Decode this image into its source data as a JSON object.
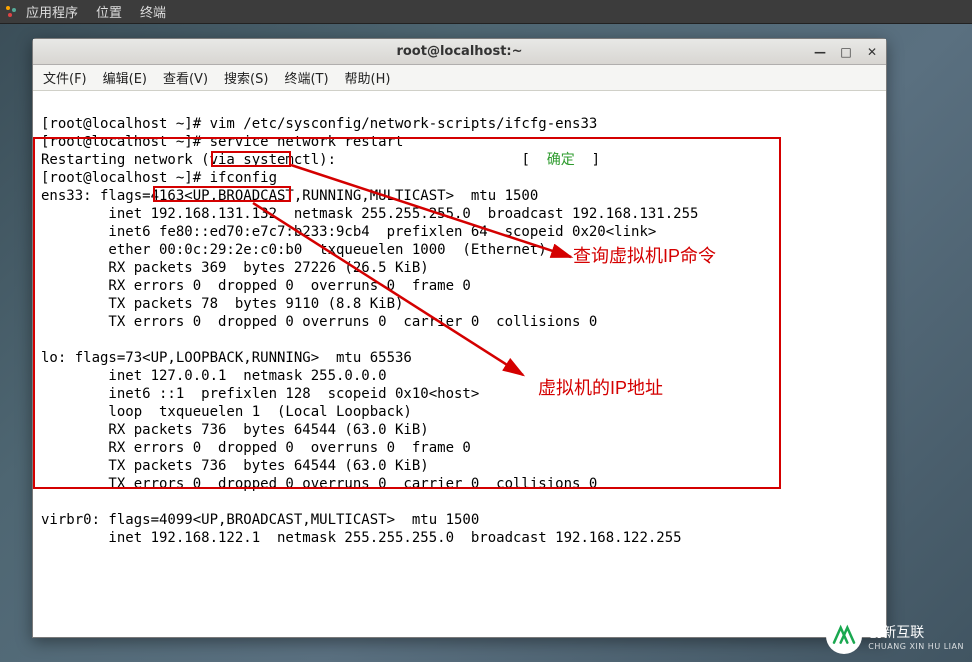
{
  "top_panel": {
    "apps": "应用程序",
    "places": "位置",
    "terminal": "终端"
  },
  "window": {
    "title": "root@localhost:~"
  },
  "menubar": {
    "file": "文件(F)",
    "edit": "编辑(E)",
    "view": "查看(V)",
    "search": "搜索(S)",
    "terminal": "终端(T)",
    "help": "帮助(H)"
  },
  "term": {
    "l1": "[root@localhost ~]# vim /etc/sysconfig/network-scripts/ifcfg-ens33",
    "l2": "[root@localhost ~]# service network restart",
    "l3a": "Restarting network (via systemctl):",
    "l3pad": "                      [  ",
    "l3ok": "确定",
    "l3end": "  ]",
    "l4": "[root@localhost ~]# ifconfig",
    "l5": "ens33: flags=4163<UP,BROADCAST,RUNNING,MULTICAST>  mtu 1500",
    "l6": "        inet 192.168.131.132  netmask 255.255.255.0  broadcast 192.168.131.255",
    "l7": "        inet6 fe80::ed70:e7c7:b233:9cb4  prefixlen 64  scopeid 0x20<link>",
    "l8": "        ether 00:0c:29:2e:c0:b0  txqueuelen 1000  (Ethernet)",
    "l9": "        RX packets 369  bytes 27226 (26.5 KiB)",
    "l10": "        RX errors 0  dropped 0  overruns 0  frame 0",
    "l11": "        TX packets 78  bytes 9110 (8.8 KiB)",
    "l12": "        TX errors 0  dropped 0 overruns 0  carrier 0  collisions 0",
    "l13": "",
    "l14": "lo: flags=73<UP,LOOPBACK,RUNNING>  mtu 65536",
    "l15": "        inet 127.0.0.1  netmask 255.0.0.0",
    "l16": "        inet6 ::1  prefixlen 128  scopeid 0x10<host>",
    "l17": "        loop  txqueuelen 1  (Local Loopback)",
    "l18": "        RX packets 736  bytes 64544 (63.0 KiB)",
    "l19": "        RX errors 0  dropped 0  overruns 0  frame 0",
    "l20": "        TX packets 736  bytes 64544 (63.0 KiB)",
    "l21": "        TX errors 0  dropped 0 overruns 0  carrier 0  collisions 0",
    "l22": "",
    "l23": "virbr0: flags=4099<UP,BROADCAST,MULTICAST>  mtu 1500",
    "l24": "        inet 192.168.122.1  netmask 255.255.255.0  broadcast 192.168.122.255"
  },
  "annotations": {
    "cmd": "查询虚拟机IP命令",
    "ip": "虚拟机的IP地址"
  },
  "watermark": {
    "logo": "CX",
    "name": "创新互联",
    "sub": "CHUANG XIN HU LIAN"
  }
}
